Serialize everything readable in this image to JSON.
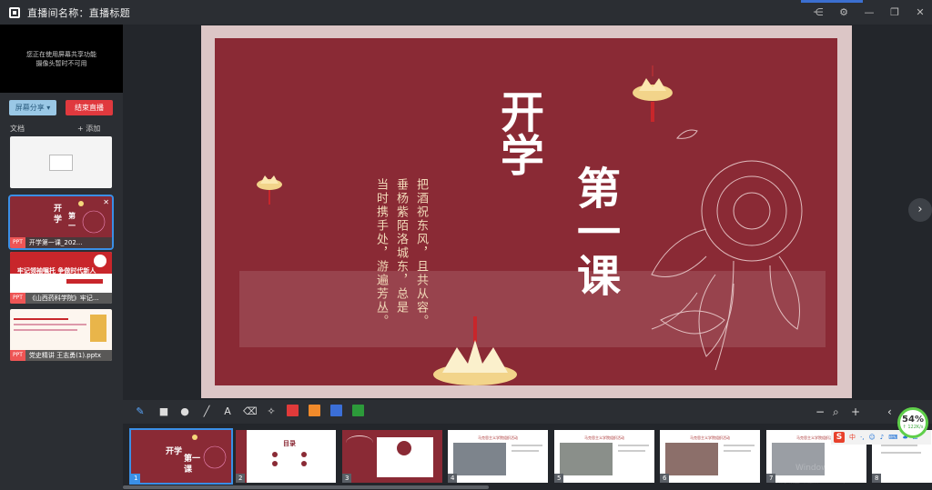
{
  "window": {
    "title": "直播间名称：直播标题",
    "controls": [
      "share-icon",
      "settings-icon",
      "minimize-icon",
      "restore-icon",
      "close-icon"
    ]
  },
  "camera": {
    "message_line1": "您正在使用屏幕共享功能",
    "message_line2": "摄像头暂时不可用"
  },
  "buttons": {
    "share_label": "屏幕分享 ▾",
    "end_label": "结束直播"
  },
  "docs": {
    "section_label": "文档",
    "add_label": "+ 添加",
    "items": [
      {
        "badge": "PPT",
        "name": "开学第一课_202...",
        "active": true
      },
      {
        "badge": "PPT",
        "name": "《山西药科学院》牢记...",
        "active": false
      },
      {
        "badge": "PPT",
        "name": "党史精讲 王志勇(1).pptx",
        "active": false
      }
    ],
    "thumb2_text": "牢记领袖嘱托 争做时代新人"
  },
  "slide": {
    "title_1": "开学",
    "title_2": "第一课",
    "poem_col1": "把酒祝东风，且共从容。",
    "poem_col2": "垂杨紫陌洛城东，总是",
    "poem_col3": "当时携手处，游遍芳丛。"
  },
  "toolbar": {
    "tools": [
      "pen-icon",
      "rectangle-icon",
      "circle-icon",
      "line-icon",
      "text-icon",
      "eraser-icon",
      "clear-icon"
    ],
    "text_tool_label": "A",
    "colors": [
      "#e03a3a",
      "#f08a2b",
      "#3b6fd8",
      "#2c9a3a"
    ],
    "zoom_out": "−",
    "zoom_in": "+"
  },
  "thumbnails": [
    {
      "num": "1",
      "active": true,
      "caption": "开学 第一课"
    },
    {
      "num": "2",
      "active": false,
      "caption": "目录"
    },
    {
      "num": "3",
      "active": false,
      "caption": ""
    },
    {
      "num": "4",
      "active": false,
      "caption": "马克思主义学院组织活动"
    },
    {
      "num": "5",
      "active": false,
      "caption": "马克思主义学院组织活动"
    },
    {
      "num": "6",
      "active": false,
      "caption": "马克思主义学院组织活动"
    },
    {
      "num": "7",
      "active": false,
      "caption": "马克思主义学院组织活动"
    },
    {
      "num": "8",
      "active": false,
      "caption": ""
    }
  ],
  "perf": {
    "percent": "54%",
    "speed": "↑ 122K/s"
  },
  "ime": {
    "cn": "中",
    "icons": [
      "punct-icon",
      "emoji-icon",
      "mic-icon",
      "keyboard-icon",
      "skin-icon",
      "grid-icon"
    ]
  },
  "watermark": {
    "line1": "Windows",
    "line2": "转到\"设置\"以激活Windows。"
  }
}
